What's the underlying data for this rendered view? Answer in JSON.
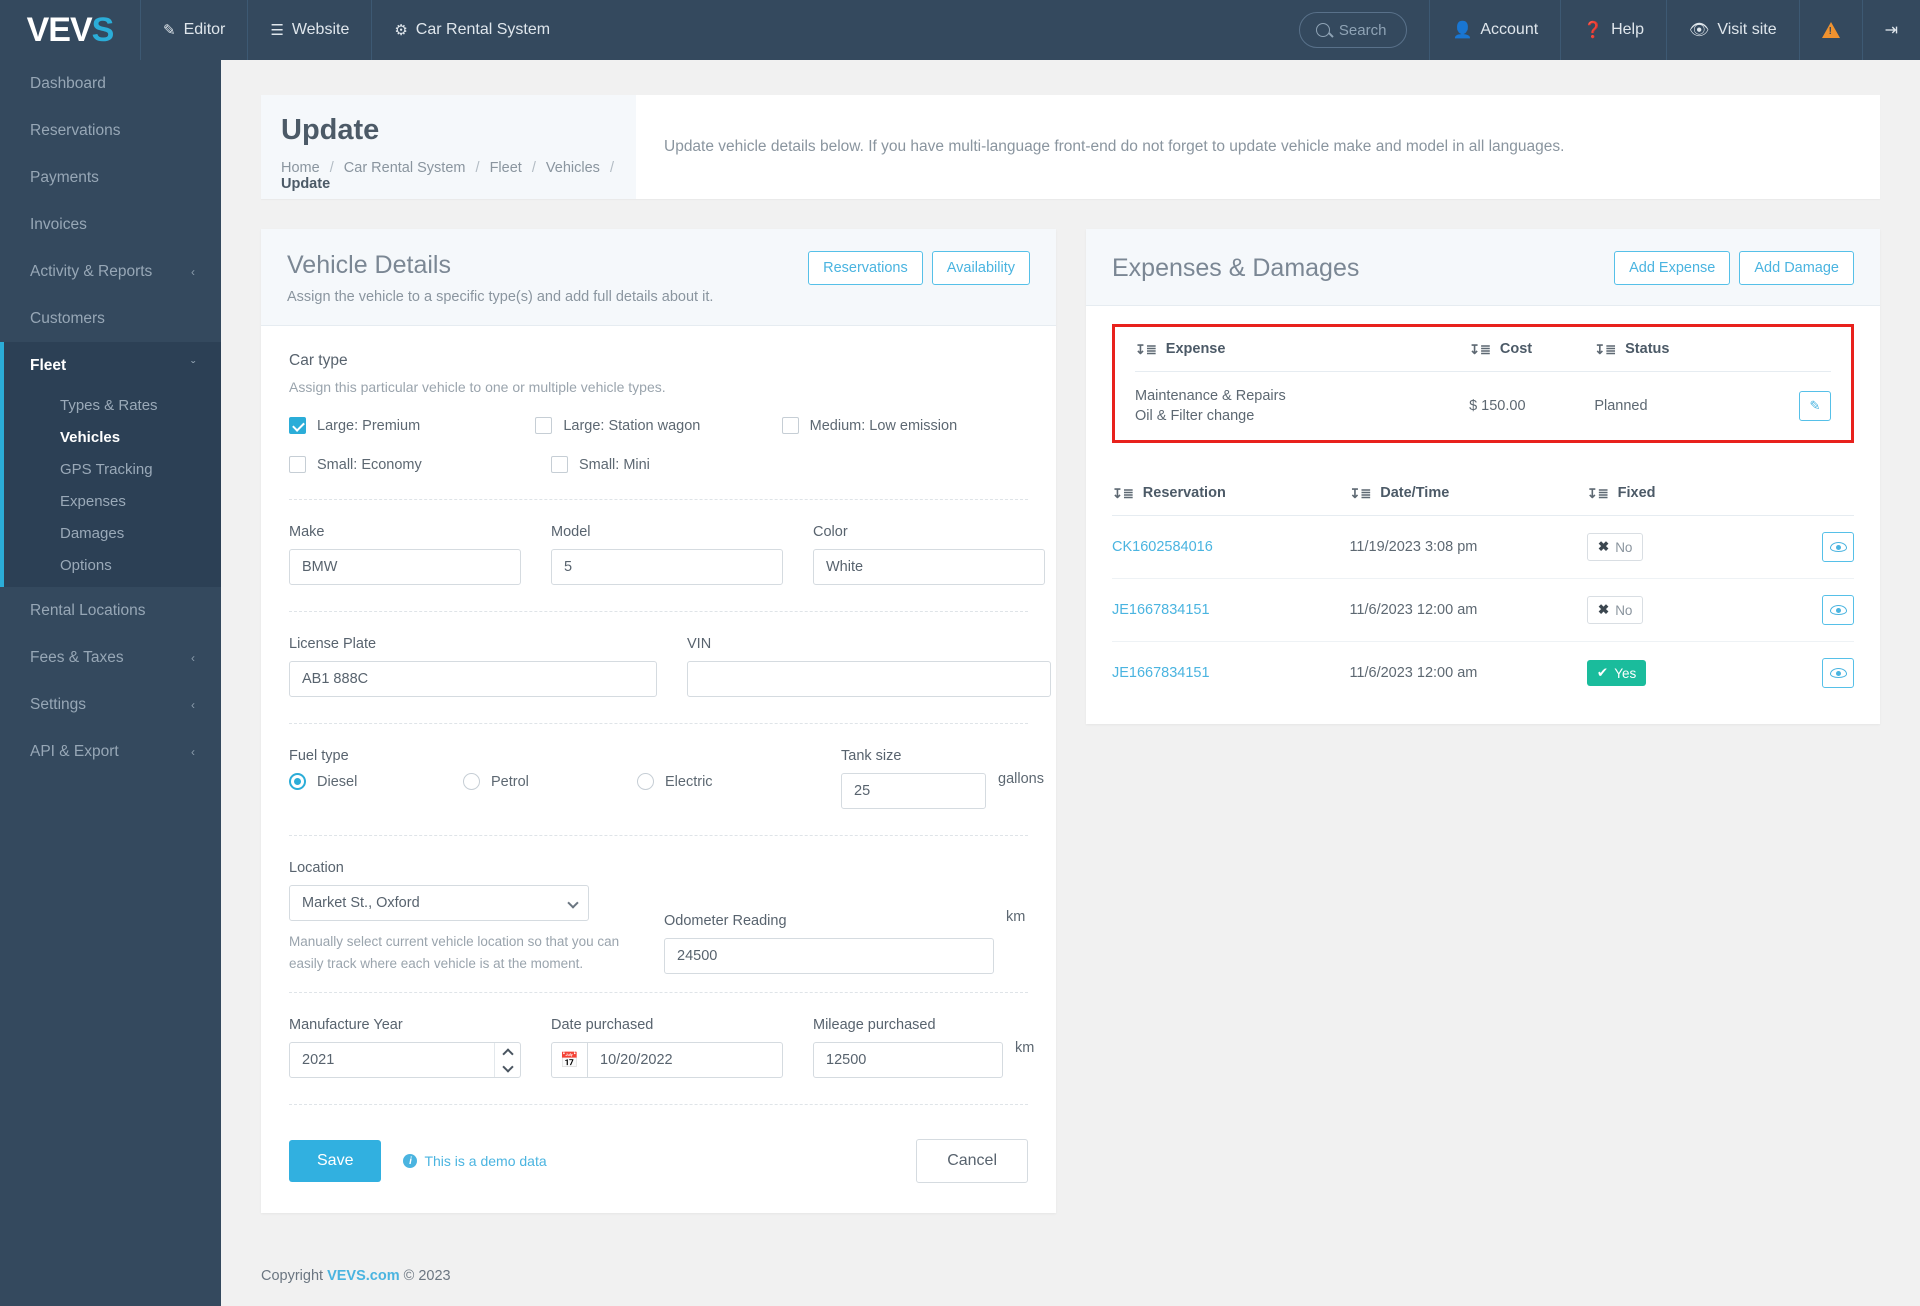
{
  "topbar": {
    "logo_text": "VEV",
    "logo_accent": "S",
    "nav": [
      {
        "label": "Editor",
        "icon": "pencil-icon"
      },
      {
        "label": "Website",
        "icon": "list-icon"
      },
      {
        "label": "Car Rental System",
        "icon": "gear-icon"
      }
    ],
    "search_placeholder": "Search",
    "right": [
      {
        "label": "Account",
        "icon": "user-icon"
      },
      {
        "label": "Help",
        "icon": "question-circle-icon"
      },
      {
        "label": "Visit site",
        "icon": "eye-icon"
      }
    ],
    "warning_icon": "warning-triangle-icon",
    "logout_icon": "logout-icon"
  },
  "sidebar": {
    "items": [
      {
        "label": "Dashboard",
        "caret": ""
      },
      {
        "label": "Reservations",
        "caret": ""
      },
      {
        "label": "Payments",
        "caret": ""
      },
      {
        "label": "Invoices",
        "caret": ""
      },
      {
        "label": "Activity & Reports",
        "caret": "‹"
      },
      {
        "label": "Customers",
        "caret": ""
      },
      {
        "label": "Fleet",
        "caret": "ˇ"
      },
      {
        "label": "Rental Locations",
        "caret": ""
      },
      {
        "label": "Fees & Taxes",
        "caret": "‹"
      },
      {
        "label": "Settings",
        "caret": "‹"
      },
      {
        "label": "API & Export",
        "caret": "‹"
      }
    ],
    "fleet_sub": [
      {
        "label": "Types & Rates"
      },
      {
        "label": "Vehicles"
      },
      {
        "label": "GPS Tracking"
      },
      {
        "label": "Expenses"
      },
      {
        "label": "Damages"
      },
      {
        "label": "Options"
      }
    ]
  },
  "page": {
    "title": "Update",
    "breadcrumb": [
      "Home",
      "Car Rental System",
      "Fleet",
      "Vehicles",
      "Update"
    ],
    "description": "Update vehicle details below. If you have multi-language front-end do not forget to update vehicle make and model in all languages."
  },
  "vehicle_details": {
    "title": "Vehicle Details",
    "subtitle": "Assign the vehicle to a specific type(s) and add full details about it.",
    "buttons": {
      "reservations": "Reservations",
      "availability": "Availability"
    },
    "car_type": {
      "label": "Car type",
      "note": "Assign this particular vehicle to one or multiple vehicle types.",
      "options": [
        {
          "label": "Large: Premium",
          "checked": true
        },
        {
          "label": "Large: Station wagon",
          "checked": false
        },
        {
          "label": "Medium: Low emission",
          "checked": false
        },
        {
          "label": "Small: Economy",
          "checked": false
        },
        {
          "label": "Small: Mini",
          "checked": false
        }
      ]
    },
    "make": {
      "label": "Make",
      "value": "BMW"
    },
    "model": {
      "label": "Model",
      "value": "5"
    },
    "color": {
      "label": "Color",
      "value": "White"
    },
    "license_plate": {
      "label": "License Plate",
      "value": "AB1 888C"
    },
    "vin": {
      "label": "VIN",
      "value": ""
    },
    "fuel_type": {
      "label": "Fuel type",
      "options": [
        {
          "label": "Diesel",
          "selected": true
        },
        {
          "label": "Petrol",
          "selected": false
        },
        {
          "label": "Electric",
          "selected": false
        }
      ]
    },
    "tank_size": {
      "label": "Tank size",
      "value": "25",
      "unit": "gallons"
    },
    "location": {
      "label": "Location",
      "value": "Market St., Oxford",
      "note": "Manually select current vehicle location so that you can easily track where each vehicle is at the moment."
    },
    "odometer": {
      "label": "Odometer Reading",
      "value": "24500",
      "unit": "km"
    },
    "manufacture_year": {
      "label": "Manufacture Year",
      "value": "2021"
    },
    "date_purchased": {
      "label": "Date purchased",
      "value": "10/20/2022",
      "icon": "calendar-icon"
    },
    "mileage_purchased": {
      "label": "Mileage purchased",
      "value": "12500",
      "unit": "km"
    },
    "save_label": "Save",
    "demo_note": "This is a demo data",
    "cancel_label": "Cancel"
  },
  "expenses_damages": {
    "title": "Expenses & Damages",
    "add_expense": "Add Expense",
    "add_damage": "Add Damage",
    "expense_table": {
      "columns": [
        "Expense",
        "Cost",
        "Status"
      ],
      "rows": [
        {
          "expense_line1": "Maintenance & Repairs",
          "expense_line2": "Oil & Filter change",
          "cost": "$ 150.00",
          "status": "Planned",
          "action_icon": "pencil-icon"
        }
      ]
    },
    "damage_table": {
      "columns": [
        "Reservation",
        "Date/Time",
        "Fixed"
      ],
      "rows": [
        {
          "reservation": "CK1602584016",
          "datetime": "11/19/2023 3:08 pm",
          "fixed": "No",
          "fixed_state": "no",
          "action_icon": "eye-icon"
        },
        {
          "reservation": "JE1667834151",
          "datetime": "11/6/2023 12:00 am",
          "fixed": "No",
          "fixed_state": "no",
          "action_icon": "eye-icon"
        },
        {
          "reservation": "JE1667834151",
          "datetime": "11/6/2023 12:00 am",
          "fixed": "Yes",
          "fixed_state": "yes",
          "action_icon": "eye-icon"
        }
      ]
    },
    "highlight_color": "#e8211c"
  },
  "footer": {
    "copyright_prefix": "Copyright",
    "link": "VEVS.com",
    "copyright_suffix": "© 2023"
  }
}
